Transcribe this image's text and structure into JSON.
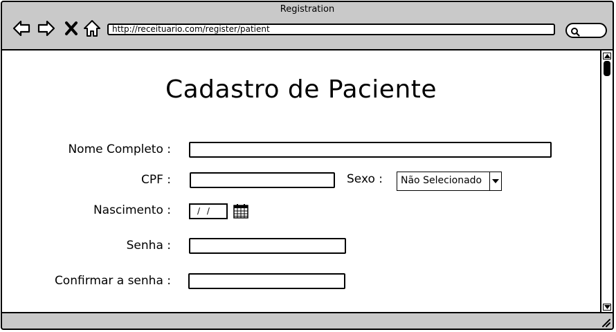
{
  "window": {
    "title": "Registration"
  },
  "toolbar": {
    "url": "http://receituario.com/register/patient",
    "icons": [
      "back-icon",
      "forward-icon",
      "stop-icon",
      "home-icon",
      "search-icon"
    ]
  },
  "form": {
    "title": "Cadastro de Paciente",
    "name_label": "Nome Completo :",
    "cpf_label": "CPF :",
    "sexo_label": "Sexo :",
    "sexo_selected": "Não Selecionado",
    "nascimento_label": "Nascimento :",
    "date_placeholder": "/ /",
    "senha_label": "Senha :",
    "confirm_label": "Confirmar a senha :"
  }
}
